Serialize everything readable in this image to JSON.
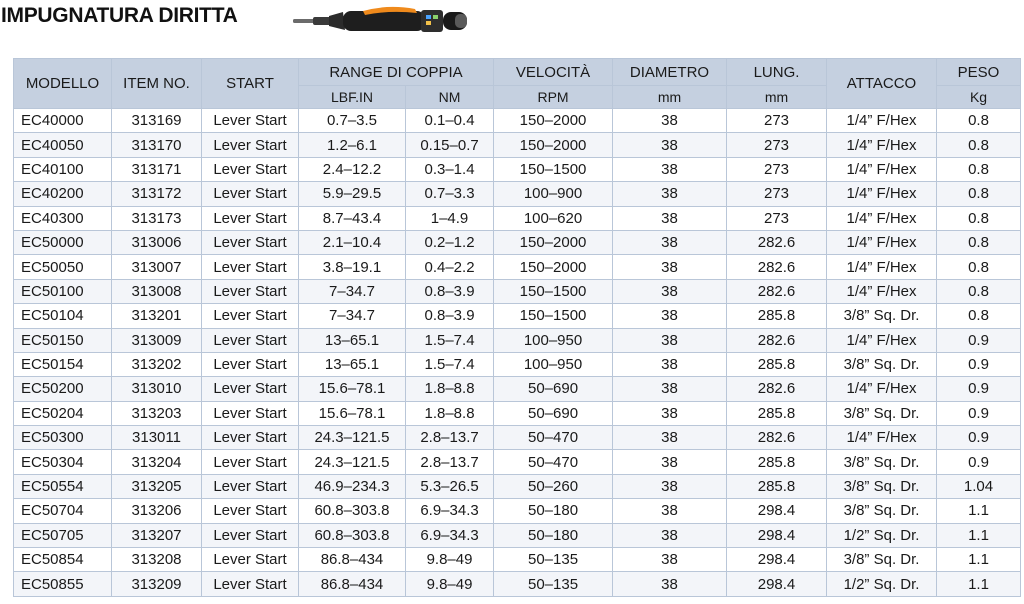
{
  "title": "IMPUGNATURA DIRITTA",
  "headers": {
    "model": "MODELLO",
    "item": "ITEM NO.",
    "start": "START",
    "torque_range": "RANGE DI COPPIA",
    "torque_lbf": "LBF.IN",
    "torque_nm": "NM",
    "speed": "VELOCITÀ",
    "speed_unit": "RPM",
    "diameter": "DIAMETRO",
    "diameter_unit": "mm",
    "length": "LUNG.",
    "length_unit": "mm",
    "attachment": "ATTACCO",
    "weight": "PESO",
    "weight_unit": "Kg"
  },
  "rows": [
    {
      "model": "EC40000",
      "item": "313169",
      "start": "Lever Start",
      "lbf": "0.7–3.5",
      "nm": "0.1–0.4",
      "rpm": "150–2000",
      "dia": "38",
      "len": "273",
      "attach": "1/4” F/Hex",
      "kg": "0.8"
    },
    {
      "model": "EC40050",
      "item": "313170",
      "start": "Lever Start",
      "lbf": "1.2–6.1",
      "nm": "0.15–0.7",
      "rpm": "150–2000",
      "dia": "38",
      "len": "273",
      "attach": "1/4” F/Hex",
      "kg": "0.8"
    },
    {
      "model": "EC40100",
      "item": "313171",
      "start": "Lever Start",
      "lbf": "2.4–12.2",
      "nm": "0.3–1.4",
      "rpm": "150–1500",
      "dia": "38",
      "len": "273",
      "attach": "1/4” F/Hex",
      "kg": "0.8"
    },
    {
      "model": "EC40200",
      "item": "313172",
      "start": "Lever Start",
      "lbf": "5.9–29.5",
      "nm": "0.7–3.3",
      "rpm": "100–900",
      "dia": "38",
      "len": "273",
      "attach": "1/4” F/Hex",
      "kg": "0.8"
    },
    {
      "model": "EC40300",
      "item": "313173",
      "start": "Lever Start",
      "lbf": "8.7–43.4",
      "nm": "1–4.9",
      "rpm": "100–620",
      "dia": "38",
      "len": "273",
      "attach": "1/4” F/Hex",
      "kg": "0.8"
    },
    {
      "model": "EC50000",
      "item": "313006",
      "start": "Lever Start",
      "lbf": "2.1–10.4",
      "nm": "0.2–1.2",
      "rpm": "150–2000",
      "dia": "38",
      "len": "282.6",
      "attach": "1/4” F/Hex",
      "kg": "0.8"
    },
    {
      "model": "EC50050",
      "item": "313007",
      "start": "Lever Start",
      "lbf": "3.8–19.1",
      "nm": "0.4–2.2",
      "rpm": "150–2000",
      "dia": "38",
      "len": "282.6",
      "attach": "1/4” F/Hex",
      "kg": "0.8"
    },
    {
      "model": "EC50100",
      "item": "313008",
      "start": "Lever Start",
      "lbf": "7–34.7",
      "nm": "0.8–3.9",
      "rpm": "150–1500",
      "dia": "38",
      "len": "282.6",
      "attach": "1/4” F/Hex",
      "kg": "0.8"
    },
    {
      "model": "EC50104",
      "item": "313201",
      "start": "Lever Start",
      "lbf": "7–34.7",
      "nm": "0.8–3.9",
      "rpm": "150–1500",
      "dia": "38",
      "len": "285.8",
      "attach": "3/8” Sq. Dr.",
      "kg": "0.8"
    },
    {
      "model": "EC50150",
      "item": "313009",
      "start": "Lever Start",
      "lbf": "13–65.1",
      "nm": "1.5–7.4",
      "rpm": "100–950",
      "dia": "38",
      "len": "282.6",
      "attach": "1/4” F/Hex",
      "kg": "0.9"
    },
    {
      "model": "EC50154",
      "item": "313202",
      "start": "Lever Start",
      "lbf": "13–65.1",
      "nm": "1.5–7.4",
      "rpm": "100–950",
      "dia": "38",
      "len": "285.8",
      "attach": "3/8” Sq. Dr.",
      "kg": "0.9"
    },
    {
      "model": "EC50200",
      "item": "313010",
      "start": "Lever Start",
      "lbf": "15.6–78.1",
      "nm": "1.8–8.8",
      "rpm": "50–690",
      "dia": "38",
      "len": "282.6",
      "attach": "1/4” F/Hex",
      "kg": "0.9"
    },
    {
      "model": "EC50204",
      "item": "313203",
      "start": "Lever Start",
      "lbf": "15.6–78.1",
      "nm": "1.8–8.8",
      "rpm": "50–690",
      "dia": "38",
      "len": "285.8",
      "attach": "3/8” Sq. Dr.",
      "kg": "0.9"
    },
    {
      "model": "EC50300",
      "item": "313011",
      "start": "Lever Start",
      "lbf": "24.3–121.5",
      "nm": "2.8–13.7",
      "rpm": "50–470",
      "dia": "38",
      "len": "282.6",
      "attach": "1/4” F/Hex",
      "kg": "0.9"
    },
    {
      "model": "EC50304",
      "item": "313204",
      "start": "Lever Start",
      "lbf": "24.3–121.5",
      "nm": "2.8–13.7",
      "rpm": "50–470",
      "dia": "38",
      "len": "285.8",
      "attach": "3/8” Sq. Dr.",
      "kg": "0.9"
    },
    {
      "model": "EC50554",
      "item": "313205",
      "start": "Lever Start",
      "lbf": "46.9–234.3",
      "nm": "5.3–26.5",
      "rpm": "50–260",
      "dia": "38",
      "len": "285.8",
      "attach": "3/8” Sq. Dr.",
      "kg": "1.04"
    },
    {
      "model": "EC50704",
      "item": "313206",
      "start": "Lever Start",
      "lbf": "60.8–303.8",
      "nm": "6.9–34.3",
      "rpm": "50–180",
      "dia": "38",
      "len": "298.4",
      "attach": "3/8” Sq. Dr.",
      "kg": "1.1"
    },
    {
      "model": "EC50705",
      "item": "313207",
      "start": "Lever Start",
      "lbf": "60.8–303.8",
      "nm": "6.9–34.3",
      "rpm": "50–180",
      "dia": "38",
      "len": "298.4",
      "attach": "1/2” Sq. Dr.",
      "kg": "1.1"
    },
    {
      "model": "EC50854",
      "item": "313208",
      "start": "Lever Start",
      "lbf": "86.8–434",
      "nm": "9.8–49",
      "rpm": "50–135",
      "dia": "38",
      "len": "298.4",
      "attach": "3/8” Sq. Dr.",
      "kg": "1.1"
    },
    {
      "model": "EC50855",
      "item": "313209",
      "start": "Lever Start",
      "lbf": "86.8–434",
      "nm": "9.8–49",
      "rpm": "50–135",
      "dia": "38",
      "len": "298.4",
      "attach": "1/2” Sq. Dr.",
      "kg": "1.1"
    }
  ]
}
